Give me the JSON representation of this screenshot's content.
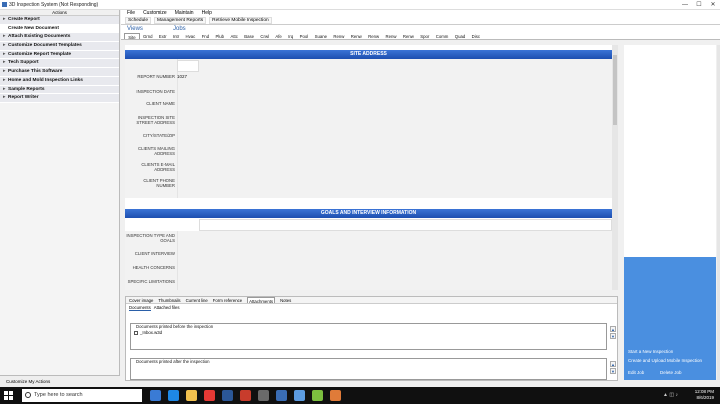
{
  "window": {
    "title": "3D Inspection System (Not Responding)",
    "min": "—",
    "max": "☐",
    "close": "✕"
  },
  "left": {
    "header": "Actions",
    "items": [
      {
        "label": "Create Report",
        "arrow": "▸"
      },
      {
        "label": "Create New Document",
        "arrow": ""
      },
      {
        "label": "Attach Existing Documents",
        "arrow": "▸"
      },
      {
        "label": "Customize Document Templates",
        "arrow": "▸"
      },
      {
        "label": "Customize Report Template",
        "arrow": "▸"
      },
      {
        "label": "Tech Support",
        "arrow": "▸"
      },
      {
        "label": "Purchase This Software",
        "arrow": "▸"
      },
      {
        "label": "Home and Mold Inspection Links",
        "arrow": "▸"
      },
      {
        "label": "Sample Reports",
        "arrow": "▸"
      },
      {
        "label": "Report Writer",
        "arrow": "▸"
      }
    ],
    "customize": "Customize My Actions"
  },
  "menu": [
    "File",
    "Customize",
    "Maintain",
    "Help"
  ],
  "toolbar": [
    "Schedule",
    "Management Reports",
    "Retrieve Mobile Inspection"
  ],
  "views": "Views",
  "jobs": "Jobs",
  "tabs": [
    "Site",
    "Grnd",
    "Extr",
    "Intr",
    "Hvac",
    "Fnd",
    "Plub",
    "Attc",
    "Base",
    "Crwl",
    "Afe",
    "Irq",
    "Pool",
    "Suane",
    "Renw",
    "Renw",
    "Renw",
    "Renw",
    "Renw",
    "Spor",
    "Comm",
    "Quad",
    "Disc"
  ],
  "form": {
    "site_header": "SITE ADDRESS",
    "goals_header": "GOALS AND INTERVIEW INFORMATION",
    "report_number_label": "REPORT NUMBER",
    "report_number_value": "1027",
    "labels": [
      "INSPECTION DATE",
      "CLIENT NAME",
      "INSPECTION SITE STREET ADDRESS",
      "CITY/STATE/ZIP",
      "CLIENTS MAILING ADDRESS",
      "CLIENTS E-MAIL ADDRESS",
      "CLIENT PHONE NUMBER"
    ],
    "goal_labels": [
      "INSPECTION TYPE AND GOALS",
      "CLIENT INTERVIEW",
      "HEALTH CONCERNS",
      "SPECIFIC LIMITATIONS"
    ]
  },
  "bottom": {
    "tabs": [
      "Cover image",
      "Thumbnails",
      "Current line",
      "Form reference",
      "Attachments",
      "Notes"
    ],
    "subtabs": [
      "Documents",
      "Attached files"
    ],
    "before": "Documents printed before the inspection",
    "file": "_Inbox.w3d",
    "after": "Documents printed after the inspection",
    "up": "▲",
    "down": "▼"
  },
  "right": {
    "start": "Start a New Inspection",
    "upload": "Create and Upload Mobile Inspection",
    "edit": "Edit Job",
    "delete": "Delete Job"
  },
  "taskbar": {
    "search": "Type here to search",
    "time": "12:08 PM",
    "date": "8/6/2019"
  }
}
